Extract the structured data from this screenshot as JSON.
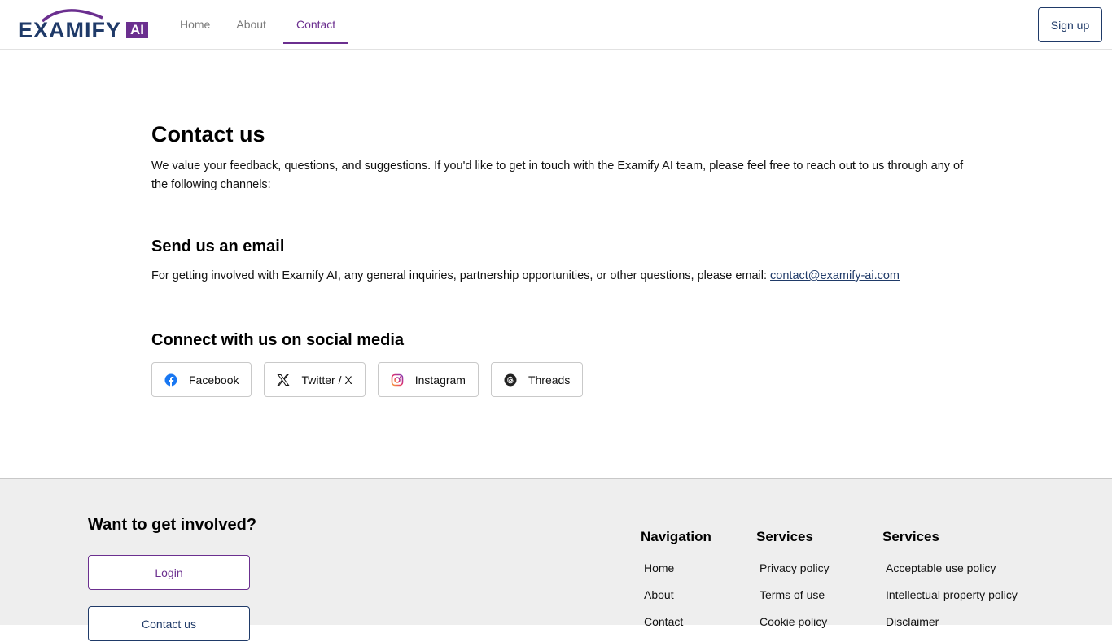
{
  "header": {
    "logo": {
      "text": "EXAMIFY",
      "badge": "AI"
    },
    "nav": [
      {
        "label": "Home",
        "active": false
      },
      {
        "label": "About",
        "active": false
      },
      {
        "label": "Contact",
        "active": true
      }
    ],
    "signup_label": "Sign up"
  },
  "main": {
    "title": "Contact us",
    "intro": "We value your feedback, questions, and suggestions. If you'd like to get in touch with the Examify AI team, please feel free to reach out to us through any of the following channels:",
    "email_heading": "Send us an email",
    "email_text": "For getting involved with Examify AI, any general inquiries, partnership opportunities, or other questions, please email: ",
    "email_address": "contact@examify-ai.com",
    "social_heading": "Connect with us on social media",
    "social": [
      {
        "label": "Facebook",
        "icon": "facebook-icon"
      },
      {
        "label": "Twitter / X",
        "icon": "x-icon"
      },
      {
        "label": "Instagram",
        "icon": "instagram-icon"
      },
      {
        "label": "Threads",
        "icon": "threads-icon"
      }
    ]
  },
  "footer": {
    "title": "Want to get involved?",
    "login_label": "Login",
    "contact_label": "Contact us",
    "columns": [
      {
        "heading": "Navigation",
        "links": [
          "Home",
          "About",
          "Contact"
        ]
      },
      {
        "heading": "Services",
        "links": [
          "Privacy policy",
          "Terms of use",
          "Cookie policy"
        ]
      },
      {
        "heading": "Services",
        "links": [
          "Acceptable use policy",
          "Intellectual property policy",
          "Disclaimer"
        ]
      }
    ]
  },
  "colors": {
    "brand_navy": "#1f3a68",
    "brand_purple": "#6b2f8f",
    "footer_bg": "#eeeeee"
  }
}
